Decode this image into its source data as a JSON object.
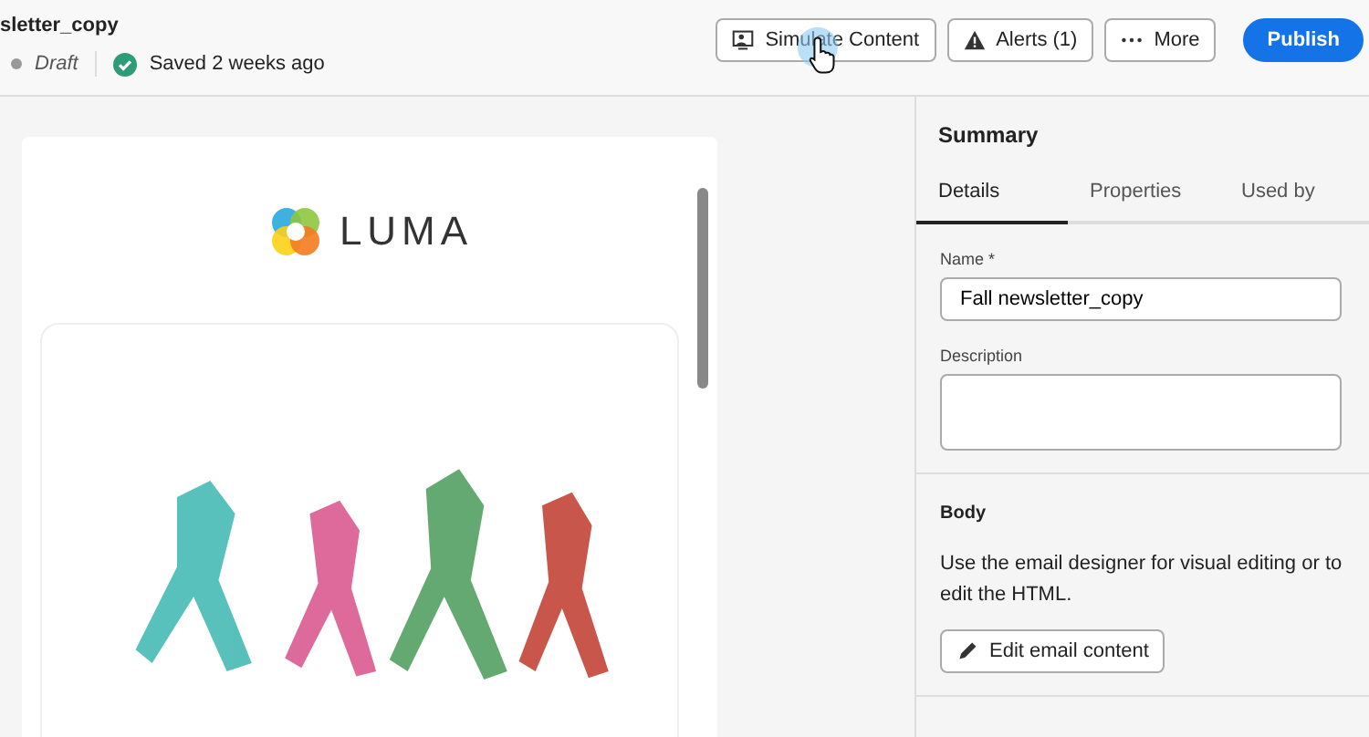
{
  "header": {
    "title": "sletter_copy",
    "status": "Draft",
    "saved": "Saved 2 weeks ago"
  },
  "actions": [
    {
      "kind": "simulate",
      "label": "Simulate Content"
    },
    {
      "kind": "alerts",
      "label": "Alerts (1)"
    },
    {
      "kind": "more",
      "label": "More"
    },
    {
      "kind": "publish",
      "label": "Publish"
    }
  ],
  "preview": {
    "logo_text": "LUMA"
  },
  "summary": {
    "title": "Summary",
    "tabs": [
      {
        "label": "Details",
        "selected": true
      },
      {
        "label": "Properties",
        "selected": false
      },
      {
        "label": "Used by",
        "selected": false
      }
    ],
    "name_label": "Name *",
    "name_value": "Fall newsletter_copy",
    "description_label": "Description",
    "body": {
      "title": "Body",
      "text": "Use the email designer for visual editing or to edit the HTML.",
      "button": "Edit email content"
    }
  }
}
